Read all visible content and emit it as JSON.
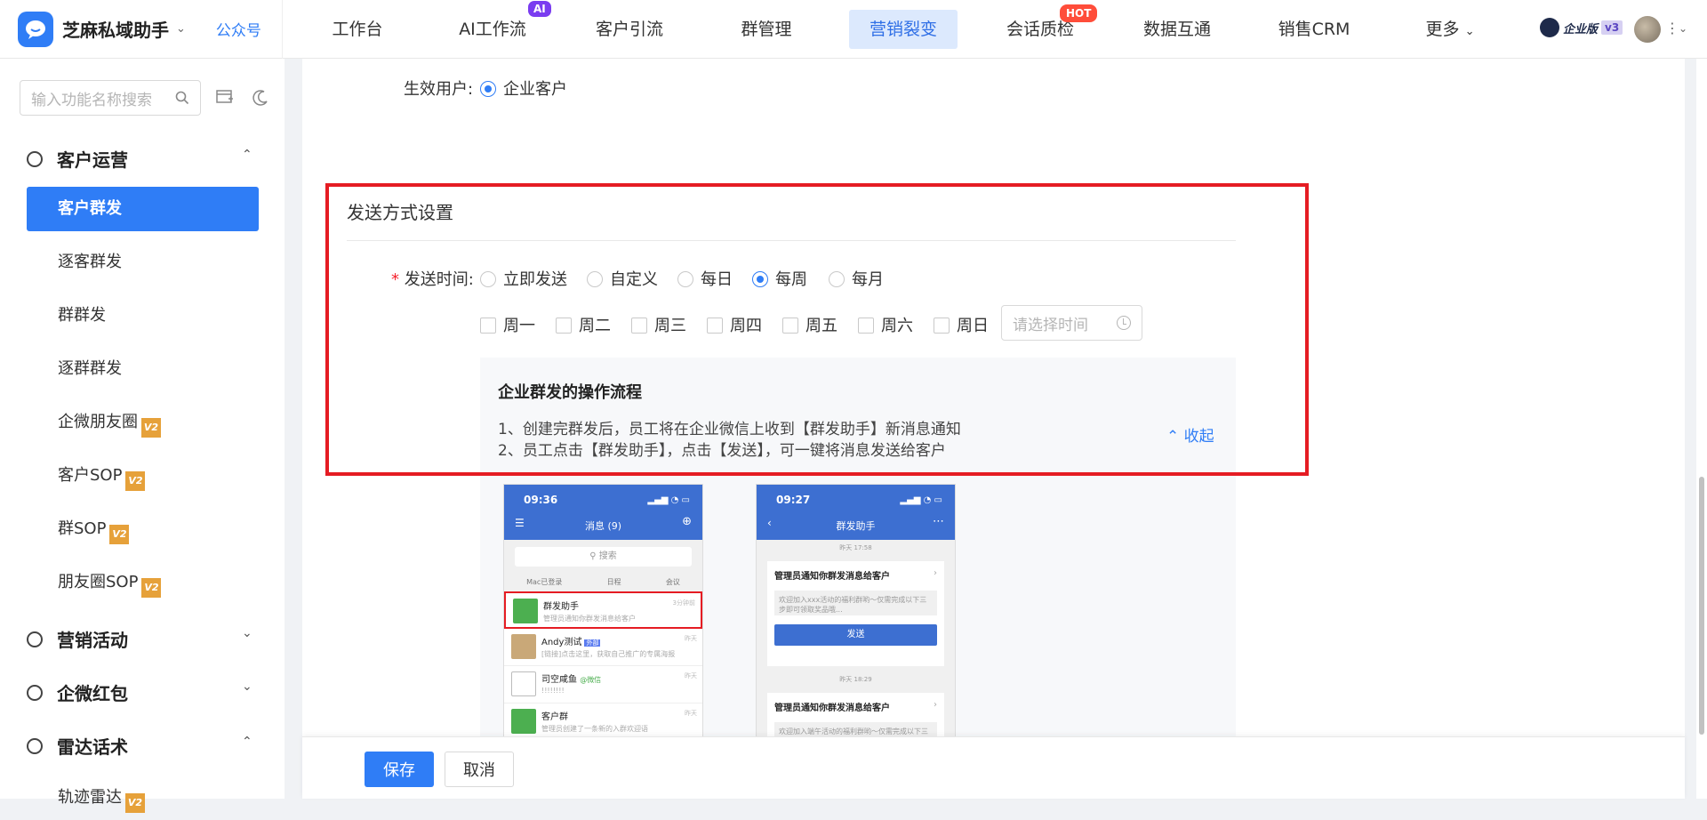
{
  "header": {
    "brand": "芝麻私域助手",
    "gzh": "公众号",
    "nav": [
      {
        "label": "工作台"
      },
      {
        "label": "AI工作流",
        "badge": "AI"
      },
      {
        "label": "客户引流"
      },
      {
        "label": "群管理"
      },
      {
        "label": "营销裂变",
        "active": true
      },
      {
        "label": "会话质检",
        "badge": "HOT"
      },
      {
        "label": "数据互通"
      },
      {
        "label": "销售CRM"
      },
      {
        "label": "更多"
      }
    ],
    "edition": "企业版",
    "edition_version": "v3"
  },
  "sidebar": {
    "search_placeholder": "输入功能名称搜索",
    "groups": [
      {
        "label": "客户运营",
        "expanded": true
      },
      {
        "label": "营销活动",
        "expanded": false
      },
      {
        "label": "企微红包",
        "expanded": false
      },
      {
        "label": "雷达话术",
        "expanded": true
      }
    ],
    "items": [
      {
        "label": "客户群发",
        "active": true
      },
      {
        "label": "逐客群发"
      },
      {
        "label": "群群发"
      },
      {
        "label": "逐群群发"
      },
      {
        "label": "企微朋友圈",
        "badge": "V2"
      },
      {
        "label": "客户SOP",
        "badge": "V2"
      },
      {
        "label": "群SOP",
        "badge": "V2"
      },
      {
        "label": "朋友圈SOP",
        "badge": "V2"
      },
      {
        "label": "轨迹雷达",
        "badge": "V2"
      }
    ],
    "v2_badge": "V2"
  },
  "form": {
    "effective_user_label": "生效用户:",
    "effective_user_option": "企业客户",
    "section_title": "发送方式设置",
    "send_time_label": "发送时间:",
    "send_time_options": [
      "立即发送",
      "自定义",
      "每日",
      "每周",
      "每月"
    ],
    "send_time_selected": "每周",
    "weekdays": [
      "周一",
      "周二",
      "周三",
      "周四",
      "周五",
      "周六",
      "周日"
    ],
    "time_placeholder": "请选择时间"
  },
  "flow": {
    "title": "企业群发的操作流程",
    "line1": "1、创建完群发后，员工将在企业微信上收到【群发助手】新消息通知",
    "line2": "2、员工点击【群发助手】，点击【发送】，可一键将消息发送给客户",
    "collapse": "收起"
  },
  "phone1": {
    "time": "09:36",
    "title": "消息 (9)",
    "search": "搜索",
    "tools": [
      "Mac已登录",
      "日程",
      "会议"
    ],
    "chats": [
      {
        "name": "群发助手",
        "msg": "管理员通知你群发消息给客户",
        "time": "3分钟前"
      },
      {
        "name": "Andy测试",
        "tag": "外部",
        "msg": "[链接]点击这里，获取自己推广的专属海报",
        "time": "昨天"
      },
      {
        "name": "司空咸鱼",
        "tag2": "@微信",
        "msg": "!!!!!!!!",
        "time": "昨天"
      },
      {
        "name": "客户群",
        "msg": "管理员创建了一条新的入群欢迎语",
        "time": "昨天"
      }
    ]
  },
  "phone2": {
    "time": "09:27",
    "title": "群发助手",
    "ts1": "昨天 17:58",
    "card_title": "管理员通知你群发消息给客户",
    "card_body1": "欢迎加入xxx活动的福利群哟～仅需完成以下三步即可领取奖品哦...",
    "send_btn": "发送",
    "ts2": "昨天 18:29",
    "card_body2": "欢迎加入端午活动的福利群哟～仅需完成以下三步即可领取奖品哦..."
  },
  "footer": {
    "save": "保存",
    "cancel": "取消"
  },
  "colors": {
    "primary": "#2f7df6",
    "highlight_box": "#e51c23",
    "ai_badge": "#7a3cf0",
    "hot_badge": "#ff4d3a",
    "v2_badge": "#e6a13a"
  }
}
